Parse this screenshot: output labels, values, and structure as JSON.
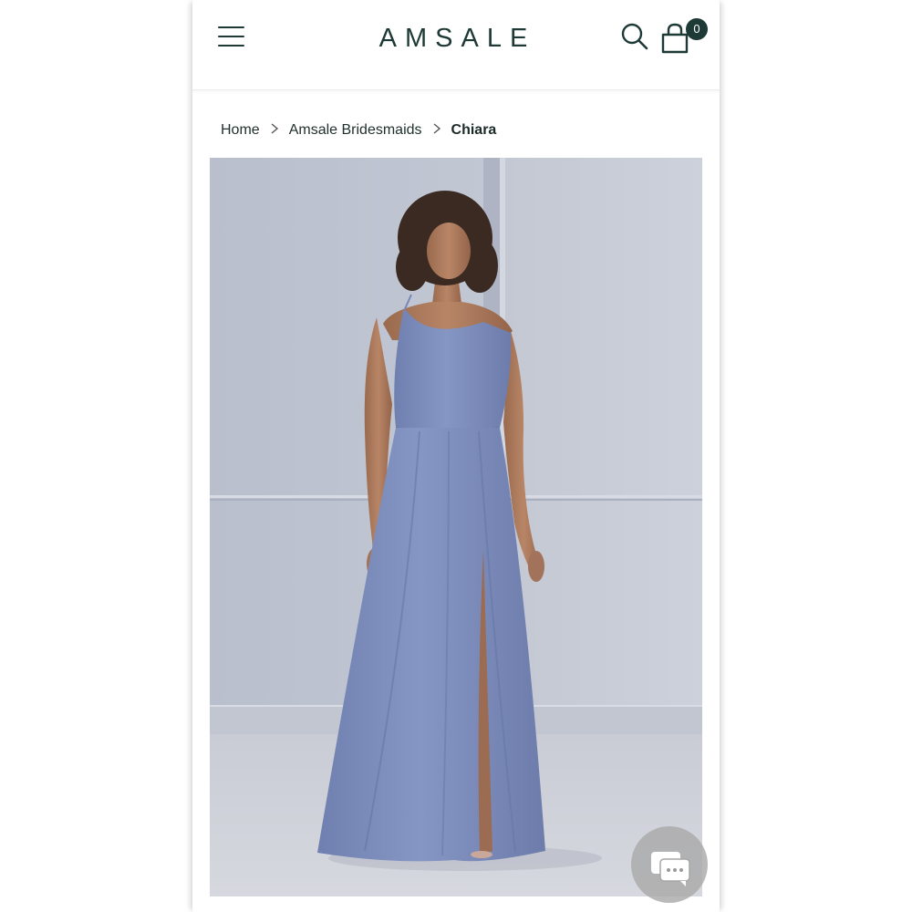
{
  "header": {
    "brand": "AMSALE",
    "menu_icon": "hamburger-menu-icon",
    "search_icon": "search-icon",
    "cart_icon": "shopping-bag-icon",
    "cart_count": "0"
  },
  "breadcrumb": {
    "items": [
      "Home",
      "Amsale Bridesmaids",
      "Chiara"
    ],
    "separator_icon": "chevron-right-icon"
  },
  "product": {
    "image_subject": "model-in-one-shoulder-dusty-blue-gown",
    "dress_color": "#7f90be"
  },
  "chat": {
    "icon": "chat-bubbles-icon"
  },
  "colors": {
    "brand": "#1e3a36",
    "background": "#ffffff",
    "photo_wall": "#c7cbd6"
  }
}
